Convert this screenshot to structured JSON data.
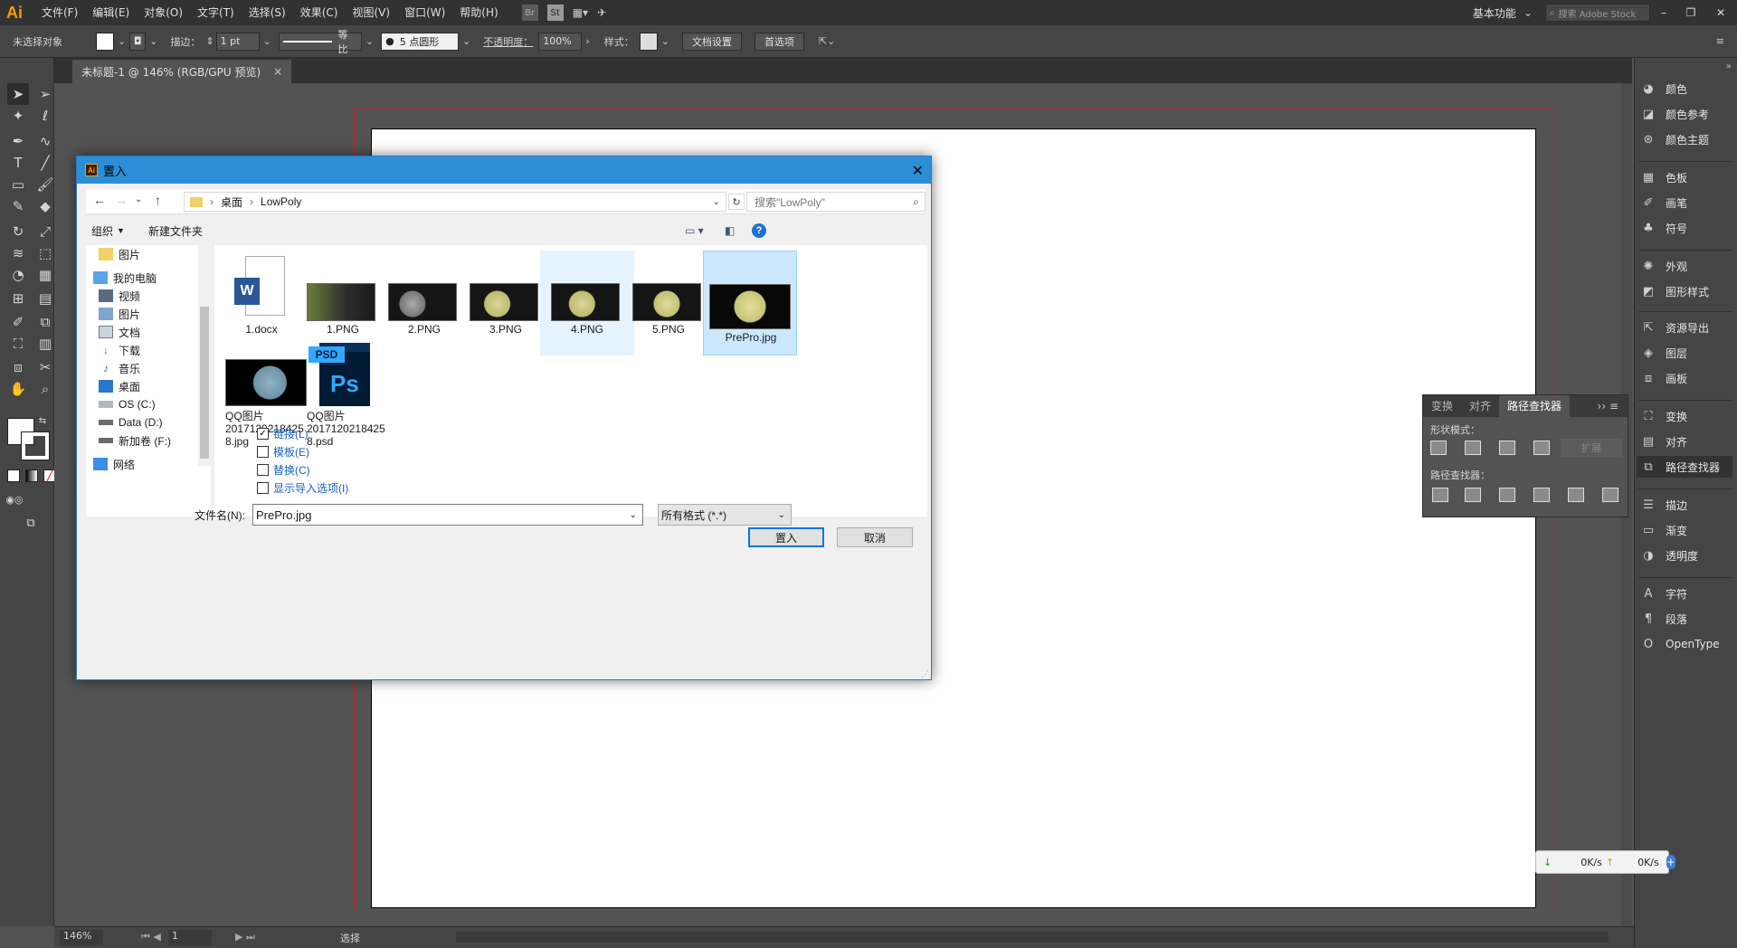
{
  "app": {
    "logo": "Ai",
    "menu": [
      "文件(F)",
      "编辑(E)",
      "对象(O)",
      "文字(T)",
      "选择(S)",
      "效果(C)",
      "视图(V)",
      "窗口(W)",
      "帮助(H)"
    ],
    "bridge_icon": "Br",
    "stock_icon": "St",
    "workspace": "基本功能",
    "search_placeholder": "搜索 Adobe Stock"
  },
  "control": {
    "selection_label": "未选择对象",
    "stroke_label": "描边：",
    "stroke_value": "1 pt",
    "stroke_profile": "等比",
    "brush": "5 点圆形",
    "opacity_label": "不透明度：",
    "opacity_value": "100%",
    "style_label": "样式：",
    "doc_setup": "文档设置",
    "preferences": "首选项"
  },
  "document": {
    "tab_title": "未标题-1 @ 146% (RGB/GPU 预览)",
    "close": "×"
  },
  "right_panels": [
    {
      "label": "颜色",
      "icon": "palette-icon"
    },
    {
      "label": "颜色参考",
      "icon": "color-guide-icon"
    },
    {
      "label": "颜色主题",
      "icon": "color-themes-icon"
    },
    {
      "label": "色板",
      "icon": "swatches-icon"
    },
    {
      "label": "画笔",
      "icon": "brush-icon"
    },
    {
      "label": "符号",
      "icon": "symbol-icon"
    },
    {
      "label": "外观",
      "icon": "appearance-icon"
    },
    {
      "label": "图形样式",
      "icon": "graphic-styles-icon"
    },
    {
      "label": "资源导出",
      "icon": "asset-export-icon"
    },
    {
      "label": "图层",
      "icon": "layers-icon"
    },
    {
      "label": "画板",
      "icon": "artboards-icon"
    },
    {
      "label": "变换",
      "icon": "transform-icon"
    },
    {
      "label": "对齐",
      "icon": "align-icon"
    },
    {
      "label": "路径查找器",
      "icon": "pathfinder-icon"
    },
    {
      "label": "描边",
      "icon": "stroke-icon"
    },
    {
      "label": "渐变",
      "icon": "gradient-icon"
    },
    {
      "label": "透明度",
      "icon": "transparency-icon"
    },
    {
      "label": "字符",
      "icon": "character-icon"
    },
    {
      "label": "段落",
      "icon": "paragraph-icon"
    },
    {
      "label": "OpenType",
      "icon": "opentype-icon"
    }
  ],
  "pathfinder": {
    "tabs": [
      "变换",
      "对齐",
      "路径查找器"
    ],
    "shape_modes": "形状模式：",
    "expand": "扩展",
    "pathfinders": "路径查找器："
  },
  "status": {
    "zoom": "146%",
    "page": "1",
    "tool": "选择"
  },
  "netmon": {
    "down": "0K/s",
    "up": "0K/s"
  },
  "dialog": {
    "title": "置入",
    "path": [
      "桌面",
      "LowPoly"
    ],
    "search_placeholder": "搜索\"LowPoly\"",
    "organize": "组织",
    "new_folder": "新建文件夹",
    "nav": [
      {
        "label": "图片",
        "icon": "folder-icon"
      },
      {
        "label": "我的电脑",
        "icon": "computer-icon"
      },
      {
        "label": "视频",
        "icon": "video-icon"
      },
      {
        "label": "图片",
        "icon": "pictures-icon"
      },
      {
        "label": "文档",
        "icon": "documents-icon"
      },
      {
        "label": "下载",
        "icon": "download-icon"
      },
      {
        "label": "音乐",
        "icon": "music-icon"
      },
      {
        "label": "桌面",
        "icon": "desktop-icon"
      },
      {
        "label": "OS (C:)",
        "icon": "drive-icon"
      },
      {
        "label": "Data (D:)",
        "icon": "drive-icon"
      },
      {
        "label": "新加卷 (F:)",
        "icon": "drive-icon"
      },
      {
        "label": "网络",
        "icon": "network-icon"
      }
    ],
    "files": [
      {
        "name": "1.docx",
        "kind": "word"
      },
      {
        "name": "1.PNG",
        "kind": "photo"
      },
      {
        "name": "2.PNG",
        "kind": "screen"
      },
      {
        "name": "3.PNG",
        "kind": "screen"
      },
      {
        "name": "4.PNG",
        "kind": "screen"
      },
      {
        "name": "5.PNG",
        "kind": "screen"
      },
      {
        "name": "PrePro.jpg",
        "kind": "dark"
      },
      {
        "name_lines": [
          "QQ图片",
          "2017120218425",
          "8.jpg"
        ],
        "kind": "qq"
      },
      {
        "name_lines": [
          "QQ图片",
          "2017120218425",
          "8.psd"
        ],
        "kind": "psd"
      }
    ],
    "options": [
      {
        "label": "链接(L)",
        "checked": true
      },
      {
        "label": "模板(E)",
        "checked": false
      },
      {
        "label": "替换(C)",
        "checked": false
      },
      {
        "label": "显示导入选项(I)",
        "checked": false
      }
    ],
    "filename_label": "文件名(N):",
    "filename": "PrePro.jpg",
    "filetype": "所有格式 (*.*)",
    "place_button": "置入",
    "cancel_button": "取消"
  }
}
